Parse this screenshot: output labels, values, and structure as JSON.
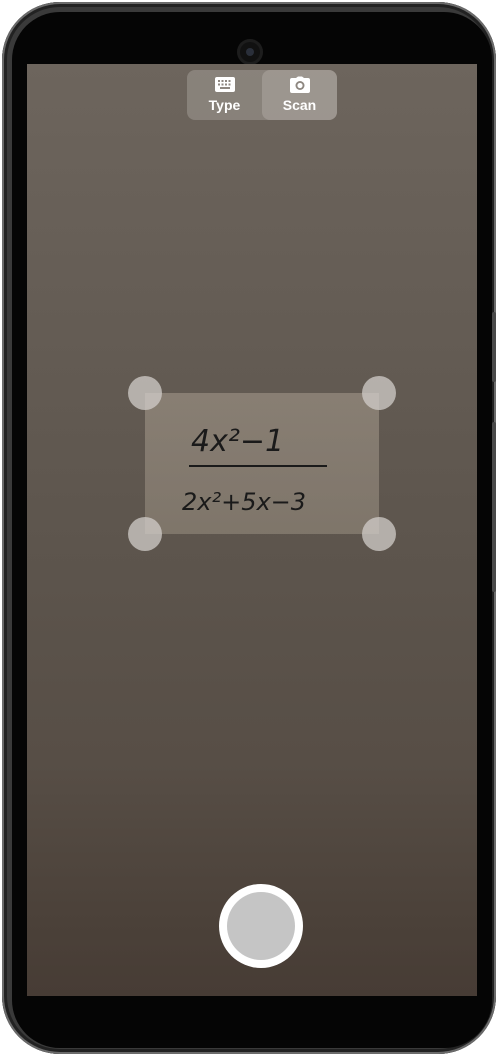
{
  "mode_switch": {
    "options": [
      {
        "label": "Type",
        "icon": "keyboard-icon",
        "selected": false
      },
      {
        "label": "Scan",
        "icon": "camera-icon",
        "selected": true
      }
    ]
  },
  "scan_region": {
    "numerator": "4x²−1",
    "denominator": "2x²+5x−3"
  },
  "shutter": {
    "icon": "shutter-button"
  }
}
